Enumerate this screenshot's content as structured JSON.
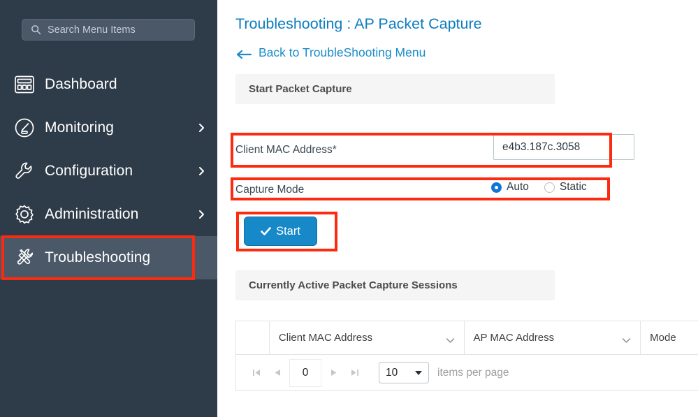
{
  "colors": {
    "sidebar_bg": "#2e3b48",
    "sidebar_active": "#4a5867",
    "accent_blue": "#0d7dbf",
    "link_blue": "#1b8cc9",
    "button_blue": "#1789c9",
    "radio_blue": "#1175d6",
    "annotation_red": "#fc2b0f",
    "panel_header_bg": "#f5f5f5"
  },
  "sidebar": {
    "search": {
      "placeholder": "Search Menu Items",
      "value": "",
      "icon": "search-icon"
    },
    "items": [
      {
        "label": "Dashboard",
        "icon": "dashboard-icon",
        "has_chevron": false,
        "active": false
      },
      {
        "label": "Monitoring",
        "icon": "gauge-icon",
        "has_chevron": true,
        "active": false
      },
      {
        "label": "Configuration",
        "icon": "wrench-icon",
        "has_chevron": true,
        "active": false
      },
      {
        "label": "Administration",
        "icon": "gear-icon",
        "has_chevron": true,
        "active": false
      },
      {
        "label": "Troubleshooting",
        "icon": "troubleshooting-icon",
        "has_chevron": false,
        "active": true
      }
    ]
  },
  "main": {
    "page_title": "Troubleshooting : AP Packet Capture",
    "back_link": "Back to TroubleShooting Menu",
    "back_icon": "arrow-left-icon",
    "start_panel": {
      "header": "Start Packet Capture",
      "mac_label": "Client MAC Address*",
      "mac_value": "e4b3.187c.3058",
      "mac_placeholder": "",
      "mode_label": "Capture Mode",
      "mode_options": [
        {
          "label": "Auto",
          "selected": true
        },
        {
          "label": "Static",
          "selected": false
        }
      ],
      "start_button": "Start",
      "start_button_icon": "check-icon"
    },
    "sessions_panel": {
      "header": "Currently Active Packet Capture Sessions",
      "table": {
        "columns": [
          {
            "label": "",
            "sortable": false
          },
          {
            "label": "Client MAC Address",
            "sortable": true
          },
          {
            "label": "AP MAC Address",
            "sortable": true
          },
          {
            "label": "Mode",
            "sortable": false
          }
        ],
        "rows": []
      },
      "pagination": {
        "first_icon": "first-page-icon",
        "prev_icon": "prev-page-icon",
        "page_value": "0",
        "next_icon": "next-page-icon",
        "last_icon": "last-page-icon",
        "page_size": "10",
        "page_size_caret": "chevron-down-icon",
        "items_per_page_label": "items per page"
      }
    }
  },
  "annotations": [
    {
      "name": "sidebar-troubleshooting-highlight"
    },
    {
      "name": "client-mac-row-highlight"
    },
    {
      "name": "capture-mode-row-highlight"
    },
    {
      "name": "start-button-highlight"
    }
  ]
}
